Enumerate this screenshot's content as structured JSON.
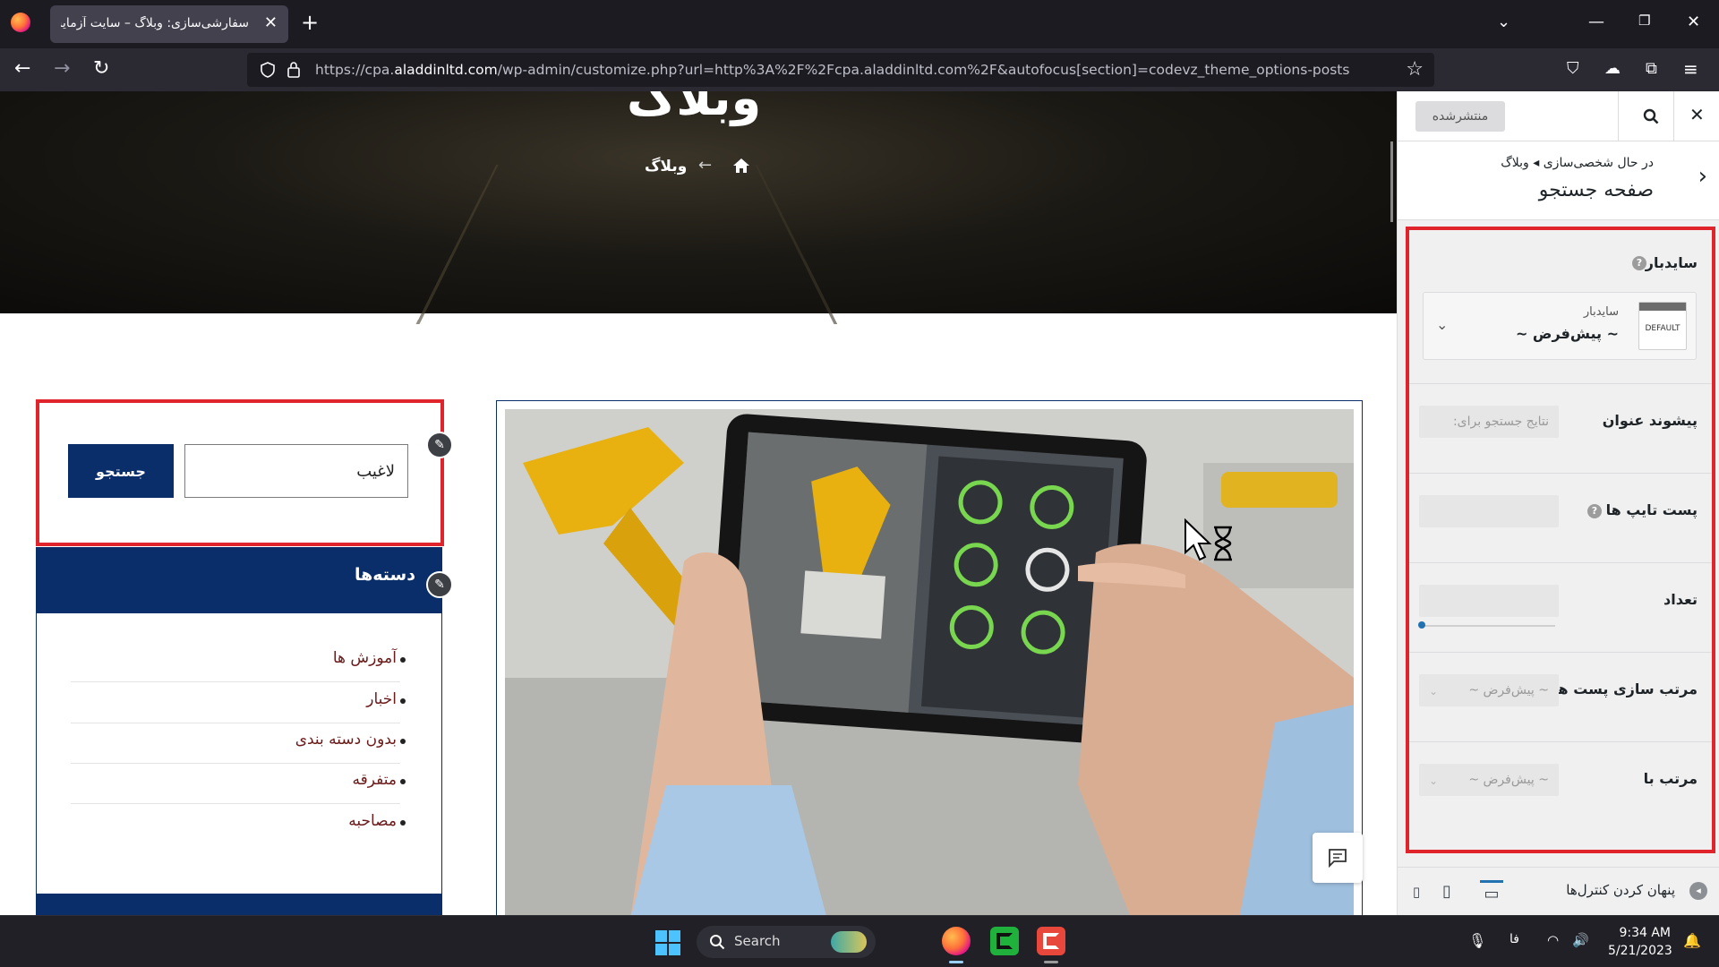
{
  "browser": {
    "tab_title": "سفارشی‌سازی: وبلاگ – سایت آزمایشی",
    "url_prefix": "https://cpa.",
    "url_domain": "aladdinltd.com",
    "url_rest": "/wp-admin/customize.php?url=http%3A%2F%2Fcpa.aladdinltd.com%2F&autofocus[section]=codevz_theme_options-posts"
  },
  "hero": {
    "title": "وبلاگ",
    "breadcrumb": "وبلاگ"
  },
  "search_widget": {
    "input_value": "لاغیب",
    "button_label": "جستجو"
  },
  "categories": {
    "title": "دسته‌ها",
    "items": [
      "آموزش ها",
      "اخبار",
      "بدون دسته بندی",
      "متفرقه",
      "مصاحبه"
    ]
  },
  "customizer": {
    "publish_label": "منتشرشده",
    "breadcrumb": "در حال شخصی‌سازی ◂ وبلاگ",
    "section_title": "صفحه جستجو",
    "sidebar_label": "سایدبار",
    "sidebar_card_sub": "سایدبار",
    "sidebar_card_value": "~ پیش‌فرض ~",
    "sidebar_thumb_text": "DEFAULT",
    "title_prefix_label": "پیشوند عنوان",
    "title_prefix_placeholder": "نتایج جستجو برای:",
    "post_types_label": "پست تایپ ها",
    "count_label": "تعداد",
    "sort_posts_label": "مرتب سازی پست ها",
    "sort_posts_value": "~ پیش‌فرض ~",
    "order_by_label": "مرتب با",
    "order_by_value": "~ پیش‌فرض ~",
    "hide_controls_label": "پنهان کردن کنترل‌ها"
  },
  "taskbar": {
    "search_label": "Search",
    "lang": "فا",
    "time": "9:34 AM",
    "date": "5/21/2023"
  }
}
